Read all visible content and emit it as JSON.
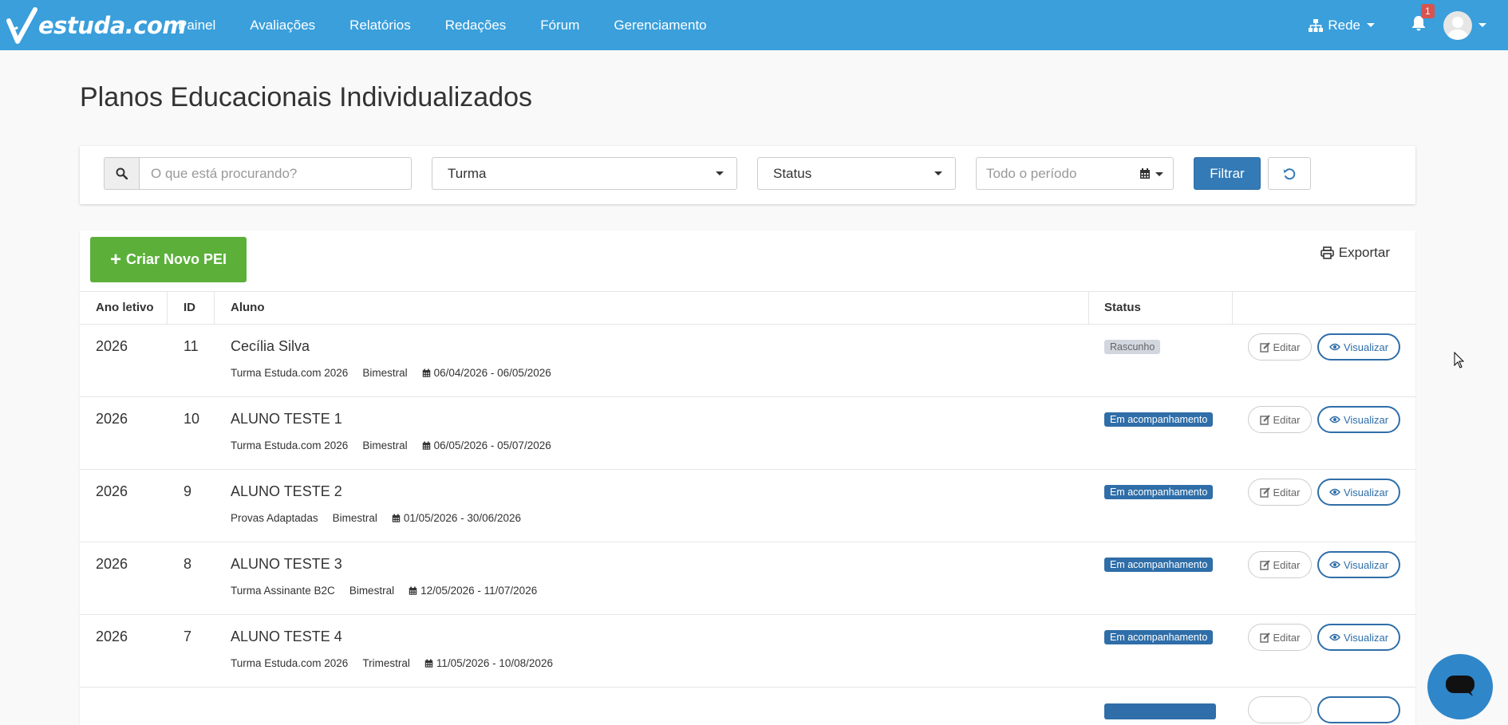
{
  "navbar": {
    "logo": "estuda.com",
    "links": [
      "Painel",
      "Avaliações",
      "Relatórios",
      "Redações",
      "Fórum",
      "Gerenciamento"
    ],
    "rede_label": "Rede",
    "notification_count": "1",
    "bg_color": "#3a9fdb"
  },
  "page": {
    "title": "Planos Educacionais Individualizados"
  },
  "filters": {
    "search_placeholder": "O que está procurando?",
    "turma_label": "Turma",
    "status_label": "Status",
    "period_placeholder": "Todo o período",
    "filter_button": "Filtrar",
    "reset_icon": "undo-icon"
  },
  "toolbar": {
    "create_label": "Criar Novo PEI",
    "export_label": "Exportar"
  },
  "table": {
    "headers": {
      "ano": "Ano letivo",
      "id": "ID",
      "aluno": "Aluno",
      "status": "Status"
    },
    "rows": [
      {
        "ano": "2026",
        "id": "11",
        "aluno": "Cecília Silva",
        "turma": "Turma Estuda.com 2026",
        "periodo": "Bimestral",
        "datas": "06/04/2026 - 06/05/2026",
        "status": "Rascunho",
        "edit": "Editar",
        "view": "Visualizar"
      },
      {
        "ano": "2026",
        "id": "10",
        "aluno": "ALUNO TESTE 1",
        "turma": "Turma Estuda.com 2026",
        "periodo": "Bimestral",
        "datas": "06/05/2026 - 05/07/2026",
        "status": "Em acompanhamento",
        "edit": "Editar",
        "view": "Visualizar"
      },
      {
        "ano": "2026",
        "id": "9",
        "aluno": "ALUNO TESTE 2",
        "turma": "Provas Adaptadas",
        "periodo": "Bimestral",
        "datas": "01/05/2026 - 30/06/2026",
        "status": "Em acompanhamento",
        "edit": "Editar",
        "view": "Visualizar"
      },
      {
        "ano": "2026",
        "id": "8",
        "aluno": "ALUNO TESTE 3",
        "turma": "Turma Assinante B2C",
        "periodo": "Bimestral",
        "datas": "12/05/2026 - 11/07/2026",
        "status": "Em acompanhamento",
        "edit": "Editar",
        "view": "Visualizar"
      },
      {
        "ano": "2026",
        "id": "7",
        "aluno": "ALUNO TESTE 4",
        "turma": "Turma Estuda.com 2026",
        "periodo": "Trimestral",
        "datas": "11/05/2026 - 10/08/2026",
        "status": "Em acompanhamento",
        "edit": "Editar",
        "view": "Visualizar"
      }
    ]
  },
  "colors": {
    "primary": "#337ab7",
    "success": "#5cb03a",
    "badge_draft": "#d2d6de",
    "badge_active": "#2f6ea8"
  }
}
